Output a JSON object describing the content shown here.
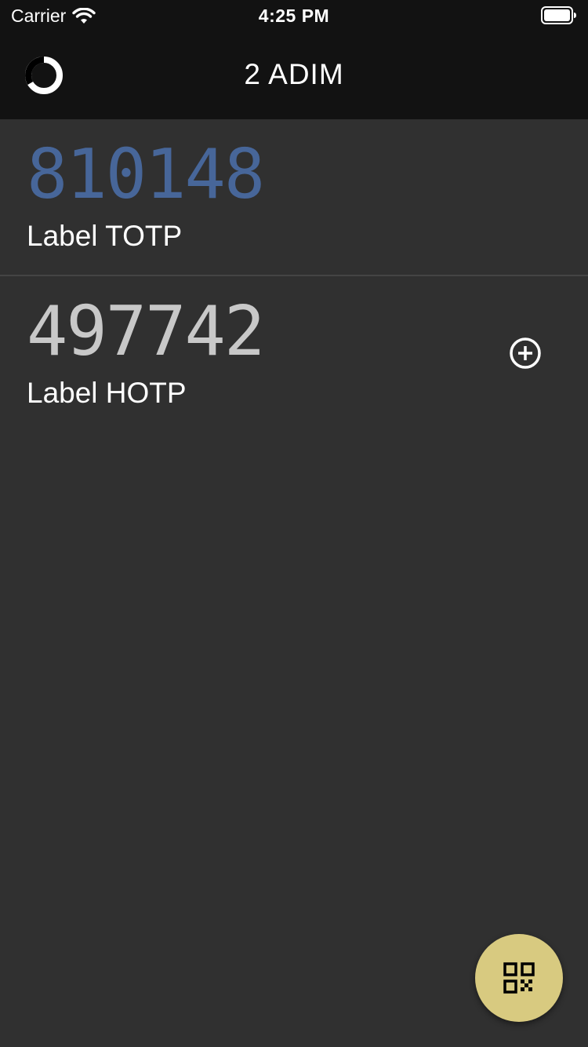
{
  "status_bar": {
    "carrier": "Carrier",
    "time": "4:25 PM",
    "wifi_icon": "wifi-icon",
    "battery_icon": "battery-full-icon"
  },
  "app_bar": {
    "title": "2 ADIM",
    "timer_icon": "countdown-timer-icon"
  },
  "tokens": [
    {
      "code": "810148",
      "label": "Label TOTP",
      "type": "TOTP",
      "code_color": "#476699"
    },
    {
      "code": "497742",
      "label": "Label HOTP",
      "type": "HOTP",
      "code_color": "#c8c8c8",
      "action_icon": "add-circle-icon"
    }
  ],
  "fab": {
    "icon": "qr-code-icon",
    "color": "#d8ca80"
  },
  "colors": {
    "background": "#303030",
    "app_bar": "#121212",
    "divider": "#444444"
  }
}
